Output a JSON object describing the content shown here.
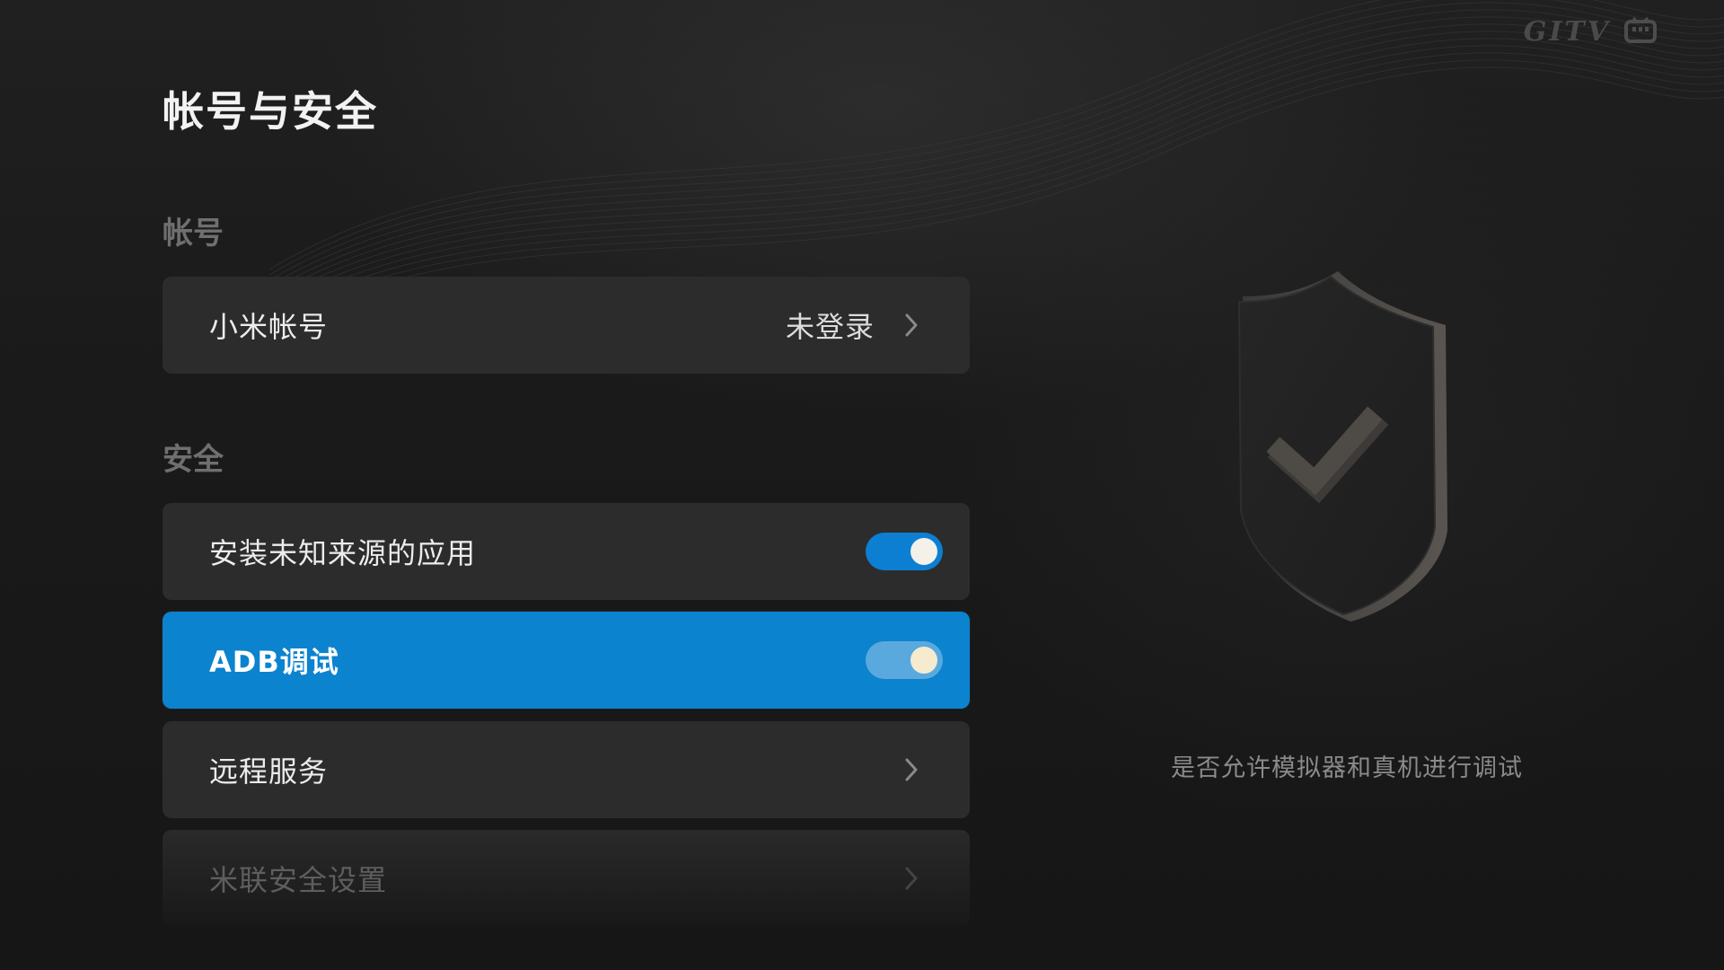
{
  "brand": {
    "logo_text": "GITV",
    "tv_icon": "tv-icon"
  },
  "page": {
    "title": "帐号与安全"
  },
  "sections": {
    "account": {
      "label": "帐号",
      "items": [
        {
          "label": "小米帐号",
          "value": "未登录",
          "icon": "chevron-right-icon"
        }
      ]
    },
    "security": {
      "label": "安全",
      "items": [
        {
          "label": "安装未知来源的应用",
          "toggle": "on"
        },
        {
          "label": "ADB调试",
          "toggle": "on",
          "focused": true
        },
        {
          "label": "远程服务",
          "icon": "chevron-right-icon"
        },
        {
          "label": "米联安全设置",
          "icon": "chevron-right-icon"
        }
      ]
    }
  },
  "side_panel": {
    "illustration": "shield-check-icon",
    "hint": "是否允许模拟器和真机进行调试"
  },
  "colors": {
    "background": "#1b1b1b",
    "row_background": "#2c2c2c",
    "focus_accent": "#0c83cf",
    "toggle_on": "#0c7fd3"
  }
}
